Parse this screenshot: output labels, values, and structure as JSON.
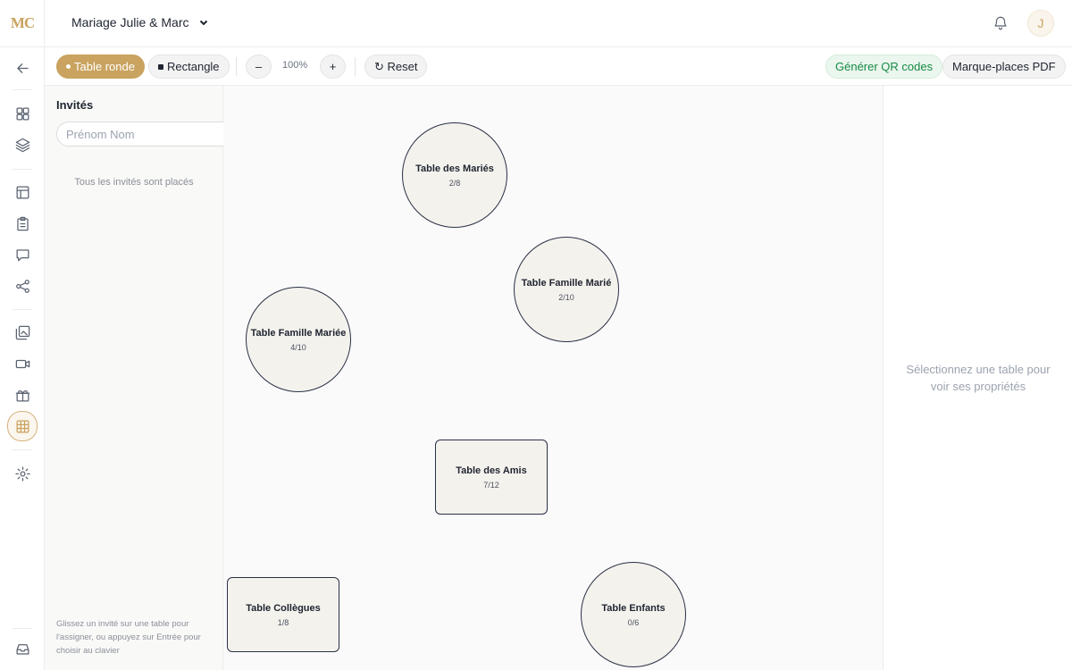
{
  "brand": {
    "logo": "MC",
    "accent": "#c9a35f"
  },
  "header": {
    "event_name": "Mariage Julie & Marc",
    "avatar_initial": "J"
  },
  "rail": {
    "icons": [
      "back-arrow-icon",
      "dashboard-icon",
      "layers-icon",
      "layout-icon",
      "clipboard-icon",
      "chat-icon",
      "share-icon",
      "gallery-icon",
      "video-icon",
      "gift-icon",
      "seating-grid-icon",
      "settings-icon",
      "inbox-icon"
    ],
    "active": "seating-grid-icon"
  },
  "toolbar": {
    "round_table": "Table ronde",
    "rectangle": "Rectangle",
    "zoom_out": "–",
    "zoom_level": "100%",
    "zoom_in": "+",
    "reset": "↻ Reset",
    "qr_codes": "Générer QR codes",
    "place_cards": "Marque-places PDF"
  },
  "guests": {
    "title": "Invités",
    "input_placeholder": "Prénom Nom",
    "all_placed": "Tous les invités sont placés",
    "hint": "Glissez un invité sur une table pour l'assigner, ou appuyez sur Entrée pour choisir au clavier"
  },
  "tables": [
    {
      "name": "Table des Mariés",
      "count": "2/8",
      "shape": "round"
    },
    {
      "name": "Table Famille Marié",
      "count": "2/10",
      "shape": "round"
    },
    {
      "name": "Table Famille Mariée",
      "count": "4/10",
      "shape": "round"
    },
    {
      "name": "Table des Amis",
      "count": "7/12",
      "shape": "rectangle"
    },
    {
      "name": "Table Collègues",
      "count": "1/8",
      "shape": "rectangle"
    },
    {
      "name": "Table Enfants",
      "count": "0/6",
      "shape": "round"
    }
  ],
  "properties": {
    "empty_text": "Sélectionnez une table pour voir ses propriétés"
  }
}
